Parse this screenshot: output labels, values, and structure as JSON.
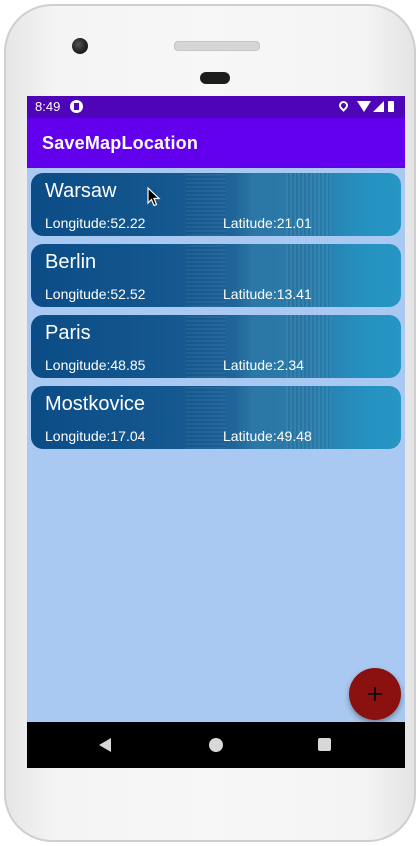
{
  "status_bar": {
    "time": "8:49",
    "icons": [
      "app-notification-icon",
      "location-icon",
      "wifi-icon",
      "cellular-signal-icon",
      "battery-icon"
    ]
  },
  "app_bar": {
    "title": "SaveMapLocation"
  },
  "locations": [
    {
      "name": "Warsaw",
      "longitude": "Longitude:52.22",
      "latitude": "Latitude:21.01"
    },
    {
      "name": "Berlin",
      "longitude": "Longitude:52.52",
      "latitude": "Latitude:13.41"
    },
    {
      "name": "Paris",
      "longitude": "Longitude:48.85",
      "latitude": "Latitude:2.34"
    },
    {
      "name": "Mostkovice",
      "longitude": "Longitude:17.04",
      "latitude": "Latitude:49.48"
    }
  ],
  "fab": {
    "icon": "plus-icon"
  },
  "nav_bar": {
    "icons": [
      "back-icon",
      "home-icon",
      "recents-icon"
    ]
  },
  "colors": {
    "status_bar": "#4d05b7",
    "app_bar": "#6200ee",
    "background": "#a9c9f2",
    "card_start": "#0b4c86",
    "card_end": "#2696c4",
    "fab": "#8b1010"
  }
}
